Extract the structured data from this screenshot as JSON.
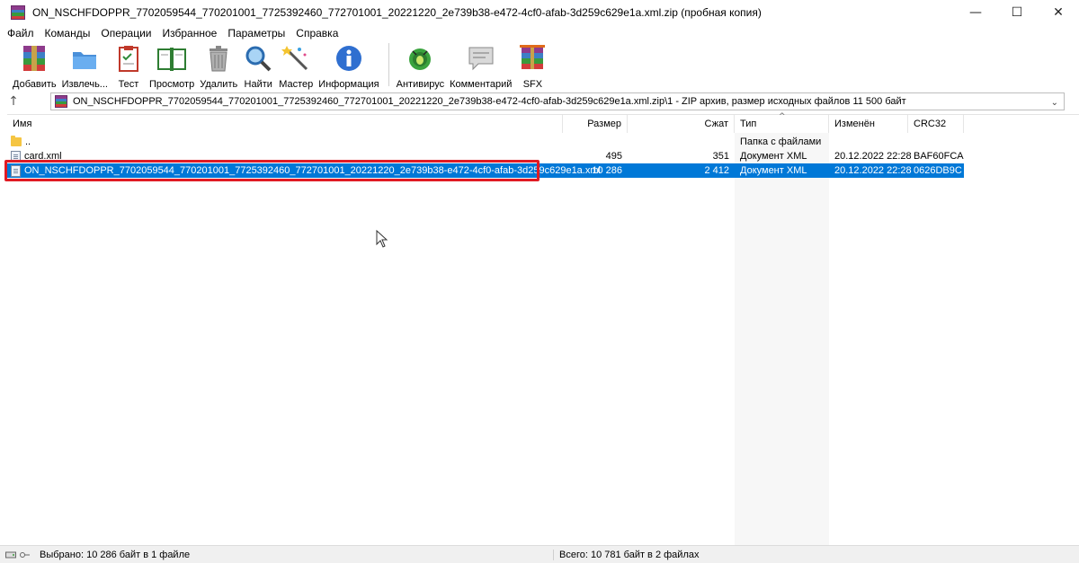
{
  "window": {
    "title": "ON_NSCHFDOPPR_7702059544_770201001_7725392460_772701001_20221220_2e739b38-e472-4cf0-afab-3d259c629e1a.xml.zip (пробная копия)",
    "minimize": "—",
    "maximize": "☐",
    "close": "✕"
  },
  "menu": [
    "Файл",
    "Команды",
    "Операции",
    "Избранное",
    "Параметры",
    "Справка"
  ],
  "toolbar": [
    {
      "label": "Добавить",
      "icon": "add-archive-icon"
    },
    {
      "label": "Извлечь...",
      "icon": "extract-folder-icon"
    },
    {
      "label": "Тест",
      "icon": "test-clipboard-icon"
    },
    {
      "label": "Просмотр",
      "icon": "view-book-icon"
    },
    {
      "label": "Удалить",
      "icon": "delete-trash-icon"
    },
    {
      "label": "Найти",
      "icon": "find-magnifier-icon"
    },
    {
      "label": "Мастер",
      "icon": "wizard-wand-icon"
    },
    {
      "label": "Информация",
      "icon": "info-icon"
    },
    {
      "label": "Антивирус",
      "icon": "antivirus-bug-icon"
    },
    {
      "label": "Комментарий",
      "icon": "comment-icon"
    },
    {
      "label": "SFX",
      "icon": "sfx-icon"
    }
  ],
  "address": {
    "path": "ON_NSCHFDOPPR_7702059544_770201001_7725392460_772701001_20221220_2e739b38-e472-4cf0-afab-3d259c629e1a.xml.zip\\1 - ZIP архив, размер исходных файлов 11 500 байт"
  },
  "columns": [
    "Имя",
    "Размер",
    "Сжат",
    "Тип",
    "Изменён",
    "CRC32"
  ],
  "rows": [
    {
      "name": "..",
      "size": "",
      "packed": "",
      "type": "Папка с файлами",
      "modified": "",
      "crc": "",
      "icon": "folder-icon"
    },
    {
      "name": "card.xml",
      "size": "495",
      "packed": "351",
      "type": "Документ XML",
      "modified": "20.12.2022 22:28",
      "crc": "BAF60FCA",
      "icon": "xml-file-icon"
    },
    {
      "name": "ON_NSCHFDOPPR_7702059544_770201001_7725392460_772701001_20221220_2e739b38-e472-4cf0-afab-3d259c629e1a.xml",
      "size": "10 286",
      "packed": "2 412",
      "type": "Документ XML",
      "modified": "20.12.2022 22:28",
      "crc": "0626DB9C",
      "icon": "xml-file-icon",
      "selected": true
    }
  ],
  "status": {
    "left": "Выбрано: 10 286 байт в 1 файле",
    "right": "Всего: 10 781 байт в 2 файлах"
  },
  "colors": {
    "selection": "#0078d7",
    "highlight_border": "#e01b24"
  }
}
